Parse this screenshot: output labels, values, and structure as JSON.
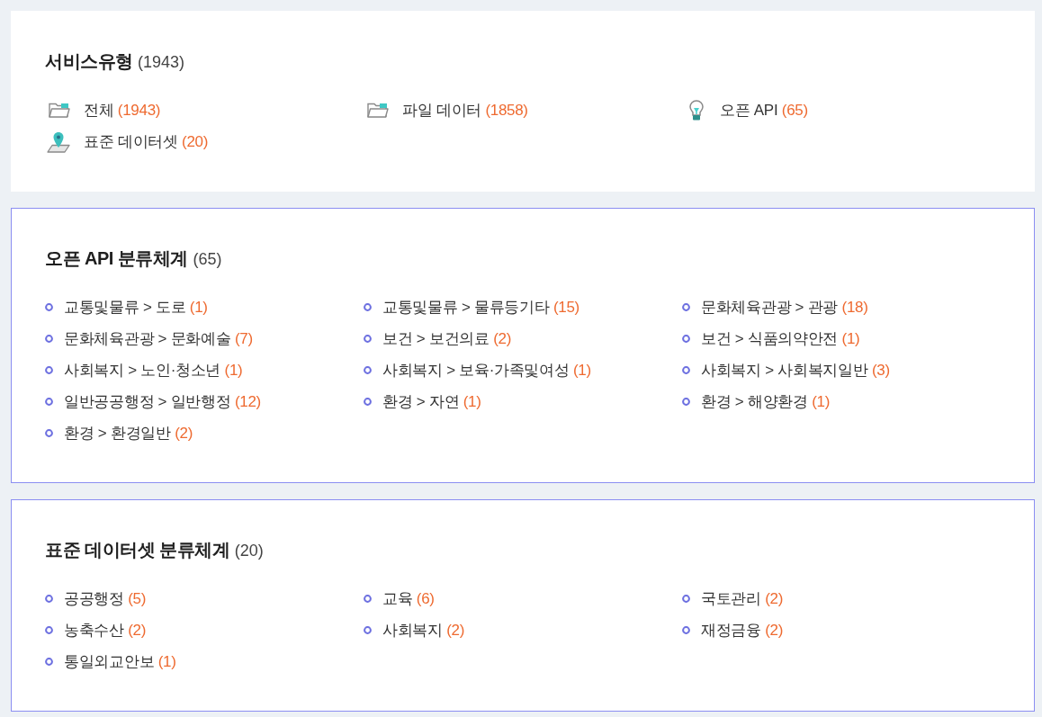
{
  "sections": [
    {
      "title": "서비스유형",
      "count": "(1943)",
      "outlined": false,
      "items": [
        {
          "kind": "folder",
          "label": "전체",
          "count": "(1943)"
        },
        {
          "kind": "folder",
          "label": "파일 데이터",
          "count": "(1858)"
        },
        {
          "kind": "bulb",
          "label": "오픈 API",
          "count": "(65)"
        },
        {
          "kind": "pin",
          "label": "표준 데이터셋",
          "count": "(20)"
        }
      ]
    },
    {
      "title": "오픈 API 분류체계",
      "count": "(65)",
      "outlined": true,
      "items": [
        {
          "kind": "bullet",
          "label": "교통및물류 > 도로",
          "count": "(1)"
        },
        {
          "kind": "bullet",
          "label": "교통및물류 > 물류등기타",
          "count": "(15)"
        },
        {
          "kind": "bullet",
          "label": "문화체육관광 > 관광",
          "count": "(18)"
        },
        {
          "kind": "bullet",
          "label": "문화체육관광 > 문화예술",
          "count": "(7)"
        },
        {
          "kind": "bullet",
          "label": "보건 > 보건의료",
          "count": "(2)"
        },
        {
          "kind": "bullet",
          "label": "보건 > 식품의약안전",
          "count": "(1)"
        },
        {
          "kind": "bullet",
          "label": "사회복지 > 노인·청소년",
          "count": "(1)"
        },
        {
          "kind": "bullet",
          "label": "사회복지 > 보육·가족및여성",
          "count": "(1)"
        },
        {
          "kind": "bullet",
          "label": "사회복지 > 사회복지일반",
          "count": "(3)"
        },
        {
          "kind": "bullet",
          "label": "일반공공행정 > 일반행정",
          "count": "(12)"
        },
        {
          "kind": "bullet",
          "label": "환경 > 자연",
          "count": "(1)"
        },
        {
          "kind": "bullet",
          "label": "환경 > 해양환경",
          "count": "(1)"
        },
        {
          "kind": "bullet",
          "label": "환경 > 환경일반",
          "count": "(2)"
        }
      ]
    },
    {
      "title": "표준 데이터셋 분류체계",
      "count": "(20)",
      "outlined": true,
      "items": [
        {
          "kind": "bullet",
          "label": "공공행정",
          "count": "(5)"
        },
        {
          "kind": "bullet",
          "label": "교육",
          "count": "(6)"
        },
        {
          "kind": "bullet",
          "label": "국토관리",
          "count": "(2)"
        },
        {
          "kind": "bullet",
          "label": "농축수산",
          "count": "(2)"
        },
        {
          "kind": "bullet",
          "label": "사회복지",
          "count": "(2)"
        },
        {
          "kind": "bullet",
          "label": "재정금융",
          "count": "(2)"
        },
        {
          "kind": "bullet",
          "label": "통일외교안보",
          "count": "(1)"
        }
      ]
    }
  ]
}
